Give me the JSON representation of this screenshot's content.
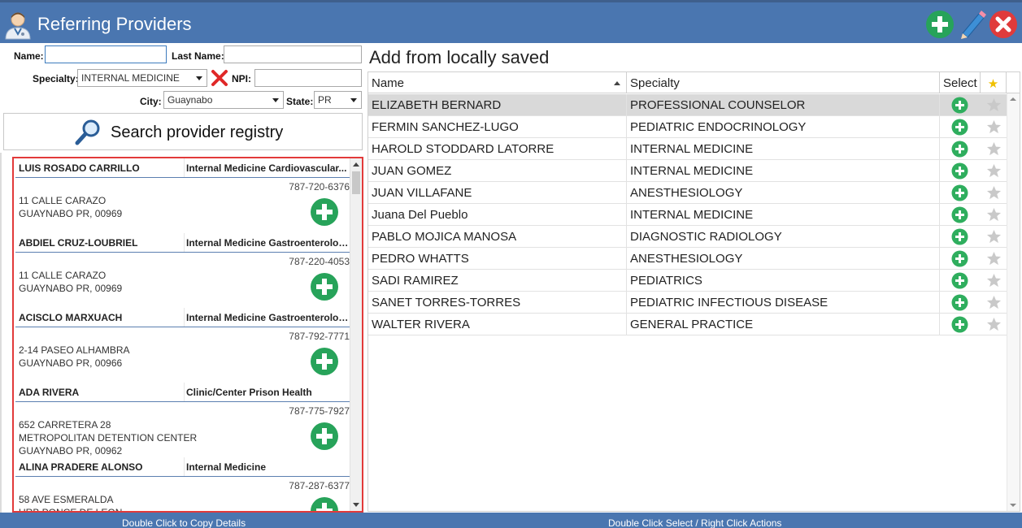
{
  "window": {
    "title": "Referring Providers",
    "icons": {
      "app": "doctor-icon",
      "add": "plus-circle-icon",
      "edit": "pencil-icon",
      "close": "close-icon"
    }
  },
  "search": {
    "name_label": "Name:",
    "name_value": "",
    "last_name_label": "Last Name:",
    "last_name_value": "",
    "specialty_label": "Specialty:",
    "specialty_value": "INTERNAL MEDICINE",
    "npi_label": "NPI:",
    "npi_value": "",
    "city_label": "City:",
    "city_value": "Guaynabo",
    "state_label": "State:",
    "state_value": "PR",
    "button_label": "Search provider registry"
  },
  "registry": [
    {
      "name": "LUIS ROSADO CARRILLO",
      "specialty": "Internal Medicine Cardiovascular...",
      "phone": "787-720-6376",
      "address": [
        "11 CALLE CARAZO",
        "GUAYNABO PR, 00969"
      ]
    },
    {
      "name": "ABDIEL CRUZ-LOUBRIEL",
      "specialty": "Internal Medicine Gastroenterology",
      "phone": "787-220-4053",
      "address": [
        "11 CALLE CARAZO",
        "GUAYNABO PR, 00969"
      ]
    },
    {
      "name": "ACISCLO MARXUACH",
      "specialty": "Internal Medicine Gastroenterology",
      "phone": "787-792-7771",
      "address": [
        "2-14 PASEO ALHAMBRA",
        "GUAYNABO PR, 00966"
      ]
    },
    {
      "name": "ADA RIVERA",
      "specialty": "Clinic/Center Prison Health",
      "phone": "787-775-7927",
      "address": [
        "652 CARRETERA 28",
        "METROPOLITAN DETENTION CENTER",
        "GUAYNABO PR, 00962"
      ]
    },
    {
      "name": "ALINA PRADERE ALONSO",
      "specialty": "Internal Medicine",
      "phone": "787-287-6377",
      "address": [
        "58 AVE ESMERALDA",
        "URB PONCE DE LEON"
      ]
    }
  ],
  "saved": {
    "title": "Add from locally saved",
    "columns": {
      "name": "Name",
      "specialty": "Specialty",
      "select": "Select",
      "favorite": "★"
    },
    "rows": [
      {
        "name": "ELIZABETH BERNARD",
        "specialty": "PROFESSIONAL COUNSELOR",
        "selected": true
      },
      {
        "name": "FERMIN SANCHEZ-LUGO",
        "specialty": "PEDIATRIC ENDOCRINOLOGY",
        "selected": false
      },
      {
        "name": "HAROLD STODDARD LATORRE",
        "specialty": "INTERNAL MEDICINE",
        "selected": false
      },
      {
        "name": "JUAN GOMEZ",
        "specialty": "INTERNAL MEDICINE",
        "selected": false
      },
      {
        "name": "JUAN VILLAFANE",
        "specialty": "ANESTHESIOLOGY",
        "selected": false
      },
      {
        "name": "Juana  Del Pueblo",
        "specialty": "INTERNAL MEDICINE",
        "selected": false
      },
      {
        "name": "PABLO MOJICA MANOSA",
        "specialty": "DIAGNOSTIC RADIOLOGY",
        "selected": false
      },
      {
        "name": "PEDRO WHATTS",
        "specialty": "ANESTHESIOLOGY",
        "selected": false
      },
      {
        "name": "SADI RAMIREZ",
        "specialty": "PEDIATRICS",
        "selected": false
      },
      {
        "name": "SANET TORRES-TORRES",
        "specialty": "PEDIATRIC INFECTIOUS DISEASE",
        "selected": false
      },
      {
        "name": "WALTER RIVERA",
        "specialty": "GENERAL PRACTICE",
        "selected": false
      }
    ]
  },
  "status": {
    "left": "Double Click to Copy Details",
    "right": "Double Click Select / Right Click Actions"
  },
  "colors": {
    "titlebar": "#4a76b0",
    "accent_green": "#27a35a",
    "highlight_border": "#e23a3a",
    "star_gold": "#f0c000"
  }
}
